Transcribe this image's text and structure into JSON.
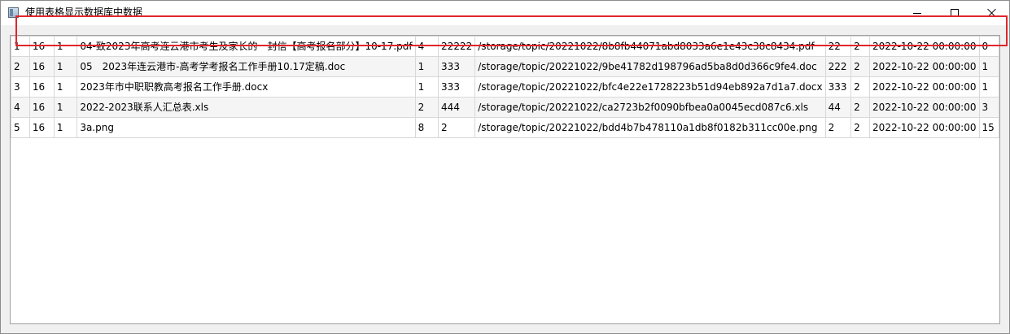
{
  "window": {
    "title": "使用表格显示数据库中数据",
    "app_icon": "window-app-icon",
    "controls": {
      "minimize": "minimize-icon",
      "maximize": "maximize-icon",
      "close": "close-icon"
    }
  },
  "table": {
    "rows": [
      [
        "1",
        "16",
        "1",
        "04-致2023年高考连云港市考生及家长的一封信【高考报名部分】10-17.pdf",
        "4",
        "22222",
        "/storage/topic/20221022/8b8fb44071abd8033a6e1e43c38c8434.pdf",
        "22",
        "2",
        "2022-10-22 00:00:00",
        "0"
      ],
      [
        "2",
        "16",
        "1",
        "05　2023年连云港市-高考学考报名工作手册10.17定稿.doc",
        "1",
        "333",
        "/storage/topic/20221022/9be41782d198796ad5ba8d0d366c9fe4.doc",
        "222",
        "2",
        "2022-10-22 00:00:00",
        "1"
      ],
      [
        "3",
        "16",
        "1",
        "2023年市中职职教高考报名工作手册.docx",
        "1",
        "333",
        "/storage/topic/20221022/bfc4e22e1728223b51d94eb892a7d1a7.docx",
        "333",
        "2",
        "2022-10-22 00:00:00",
        "1"
      ],
      [
        "4",
        "16",
        "1",
        "2022-2023联系人汇总表.xls",
        "2",
        "444",
        "/storage/topic/20221022/ca2723b2f0090bfbea0a0045ecd087c6.xls",
        "44",
        "2",
        "2022-10-22 00:00:00",
        "3"
      ],
      [
        "5",
        "16",
        "1",
        "3a.png",
        "8",
        "2",
        "/storage/topic/20221022/bdd4b7b478110a1db8f0182b311cc00e.png",
        "2",
        "2",
        "2022-10-22 00:00:00",
        "15"
      ]
    ]
  },
  "annotation": {
    "highlight_color": "#e0262b"
  }
}
